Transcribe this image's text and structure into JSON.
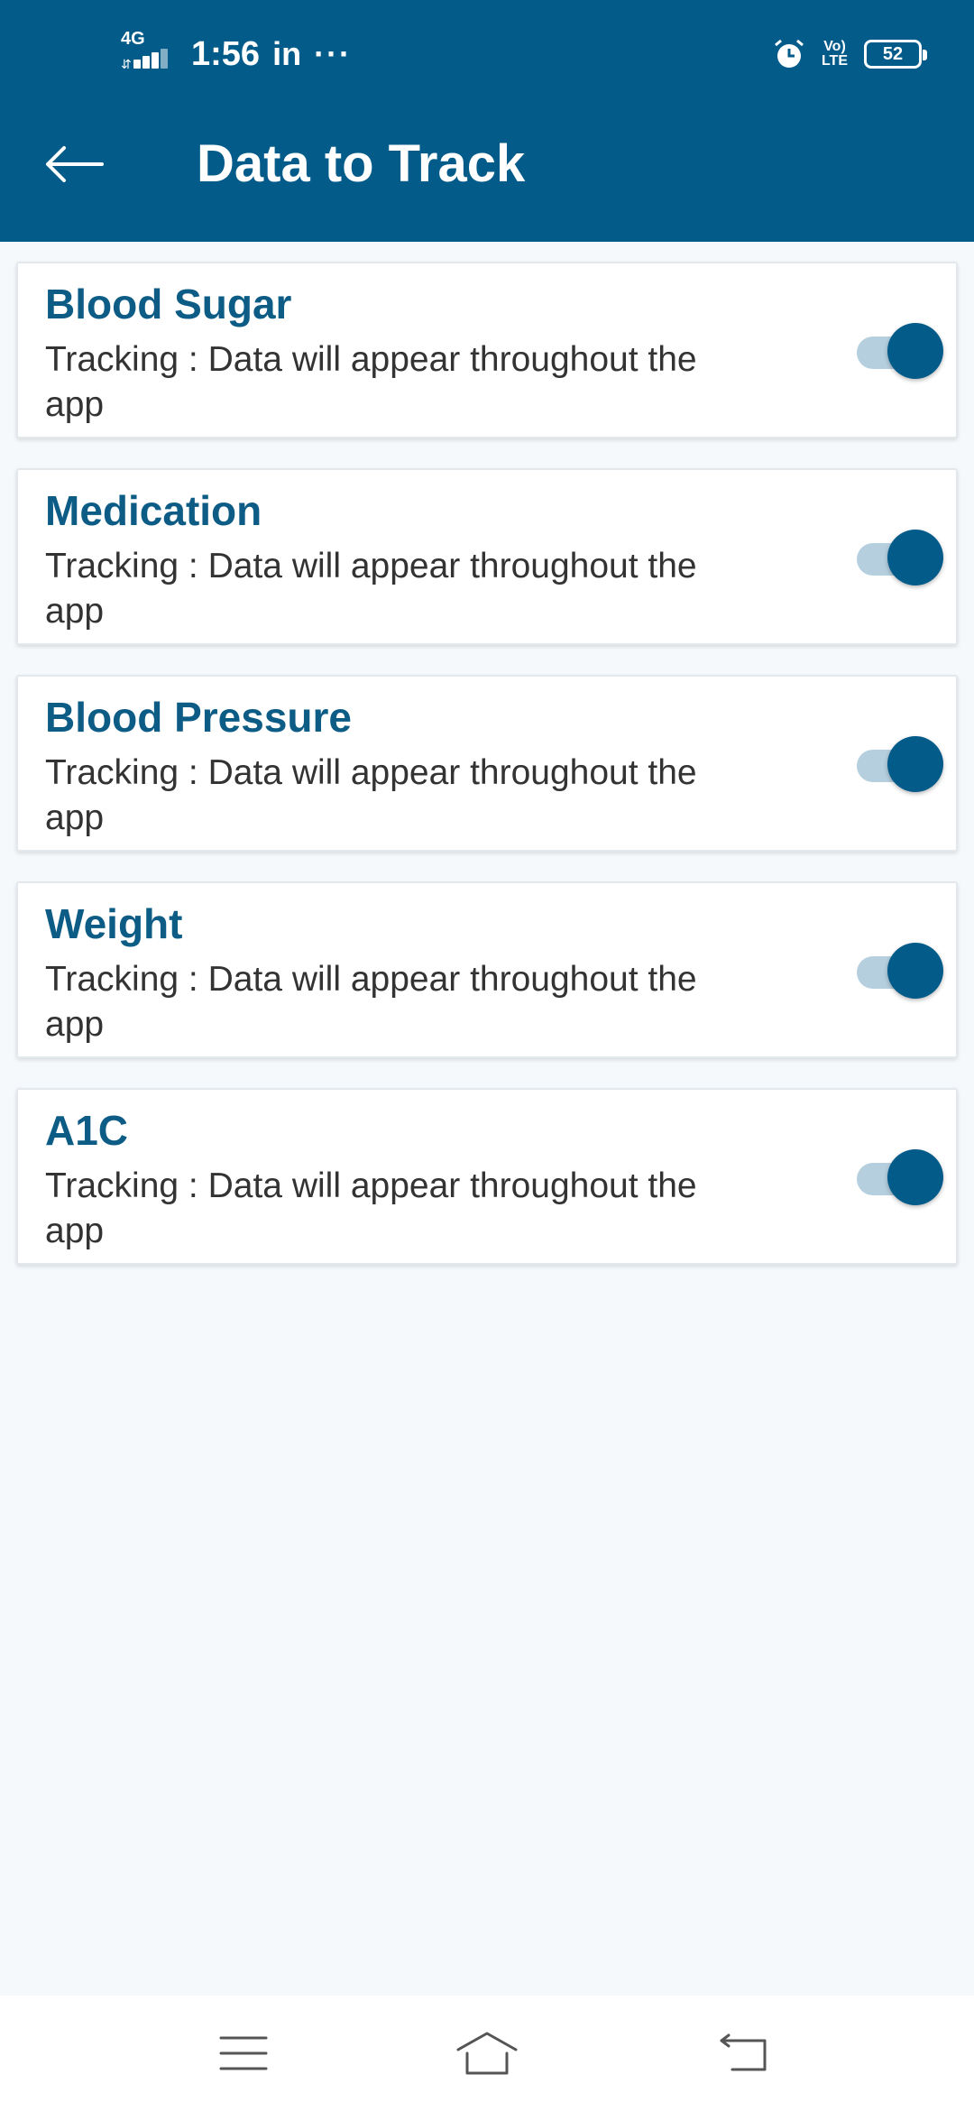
{
  "status_bar": {
    "network": "4G",
    "time": "1:56",
    "notification_app": "in",
    "more": "···",
    "alarm_icon": "alarm-clock-icon",
    "volte_line1": "Vo)",
    "volte_line2": "LTE",
    "battery": "52"
  },
  "header": {
    "title": "Data to Track",
    "back_icon": "arrow-left-icon",
    "background_color": "#035b8a"
  },
  "items": [
    {
      "title": "Blood Sugar",
      "description": "Tracking : Data will appear throughout the app",
      "enabled": true
    },
    {
      "title": "Medication",
      "description": "Tracking : Data will appear throughout the app",
      "enabled": true
    },
    {
      "title": "Blood Pressure",
      "description": "Tracking : Data will appear throughout the app",
      "enabled": true
    },
    {
      "title": "Weight",
      "description": "Tracking : Data will appear throughout the app",
      "enabled": true
    },
    {
      "title": "A1C",
      "description": "Tracking : Data will appear throughout the app",
      "enabled": true
    }
  ],
  "colors": {
    "accent": "#035b8a",
    "title_text": "#0c5c86",
    "toggle_track": "#b5cfdf",
    "page_background": "#f5f9fc"
  },
  "nav_bar": {
    "menu_icon": "menu-icon",
    "home_icon": "home-icon",
    "back_icon": "back-icon"
  }
}
